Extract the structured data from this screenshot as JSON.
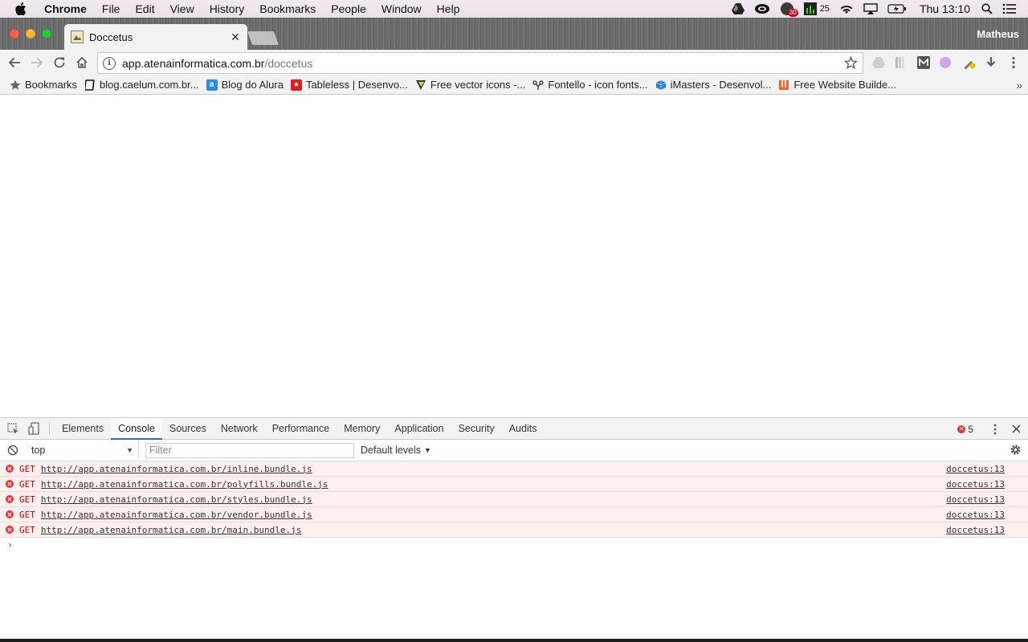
{
  "menubar": {
    "app_name": "Chrome",
    "items": [
      "File",
      "Edit",
      "View",
      "History",
      "Bookmarks",
      "People",
      "Window",
      "Help"
    ],
    "tray_badge_count": "30",
    "tray_counter": "25",
    "clock": "Thu 13:10"
  },
  "browser": {
    "tab_title": "Doccetus",
    "profile_name": "Matheus",
    "url_host": "app.atenainformatica.com.br",
    "url_path": "/doccetus",
    "bookmarks": [
      {
        "label": "Bookmarks",
        "icon": "star-icon"
      },
      {
        "label": "blog.caelum.com.br...",
        "icon": "caelum-icon"
      },
      {
        "label": "Blog do Alura",
        "icon": "alura-icon"
      },
      {
        "label": "Tableless | Desenvo...",
        "icon": "tableless-icon"
      },
      {
        "label": "Free vector icons -...",
        "icon": "flaticon-icon"
      },
      {
        "label": "Fontello - icon fonts...",
        "icon": "fontello-icon"
      },
      {
        "label": "iMasters - Desenvol...",
        "icon": "imasters-icon"
      },
      {
        "label": "Free Website Builde...",
        "icon": "weebly-icon"
      }
    ]
  },
  "devtools": {
    "tabs": [
      "Elements",
      "Console",
      "Sources",
      "Network",
      "Performance",
      "Memory",
      "Application",
      "Security",
      "Audits"
    ],
    "active_tab": "Console",
    "error_count": "5",
    "context": "top",
    "filter_placeholder": "Filter",
    "levels": "Default levels",
    "messages": [
      {
        "method": "GET",
        "url": "http://app.atenainformatica.com.br/inline.bundle.js",
        "source": "doccetus:13"
      },
      {
        "method": "GET",
        "url": "http://app.atenainformatica.com.br/polyfills.bundle.js",
        "source": "doccetus:13"
      },
      {
        "method": "GET",
        "url": "http://app.atenainformatica.com.br/styles.bundle.js",
        "source": "doccetus:13"
      },
      {
        "method": "GET",
        "url": "http://app.atenainformatica.com.br/vendor.bundle.js",
        "source": "doccetus:13"
      },
      {
        "method": "GET",
        "url": "http://app.atenainformatica.com.br/main.bundle.js",
        "source": "doccetus:13"
      }
    ],
    "prompt_symbol": "›"
  },
  "colors": {
    "error_red": "#e8333a",
    "error_bg": "#fff0f0",
    "accent_blue": "#2a69d8"
  }
}
